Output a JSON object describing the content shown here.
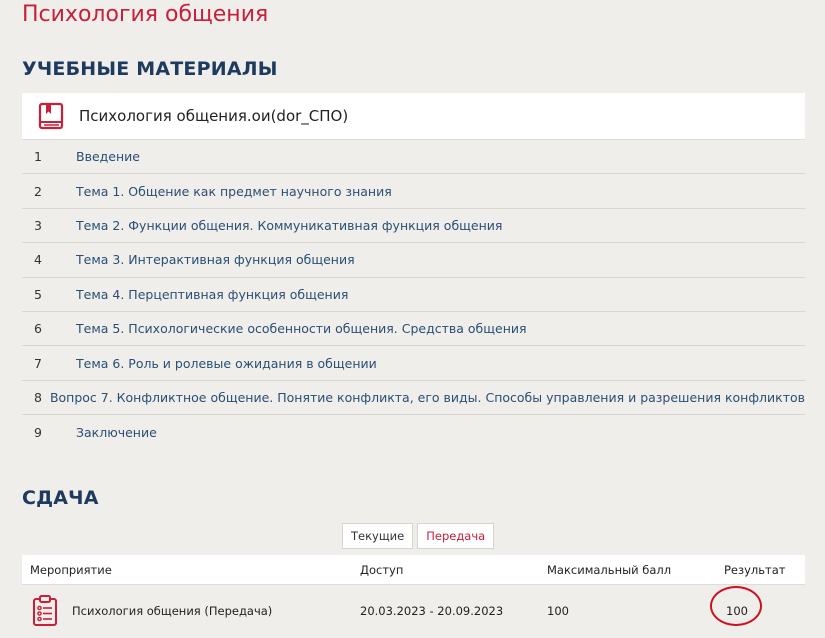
{
  "page_title": "Психология общения",
  "materials": {
    "title": "УЧЕБНЫЕ МАТЕРИАЛЫ",
    "course_name": "Психология общения.ои(dor_СПО)",
    "items": [
      {
        "num": "1",
        "label": "Введение"
      },
      {
        "num": "2",
        "label": "Тема 1. Общение как предмет научного знания"
      },
      {
        "num": "3",
        "label": "Тема 2. Функции общения. Коммуникативная функция общения"
      },
      {
        "num": "4",
        "label": "Тема 3. Интерактивная функция общения"
      },
      {
        "num": "5",
        "label": "Тема 4. Перцептивная функция общения"
      },
      {
        "num": "6",
        "label": "Тема 5. Психологические особенности общения. Средства общения"
      },
      {
        "num": "7",
        "label": "Тема 6. Роль и ролевые ожидания в общении"
      },
      {
        "num": "8",
        "label": "Вопрос 7. Конфликтное общение. Понятие конфликта, его виды. Способы управления и разрешения конфликтов"
      },
      {
        "num": "9",
        "label": "Заключение"
      }
    ]
  },
  "sdacha": {
    "title": "СДАЧА",
    "tabs": {
      "current": "Текущие",
      "retake": "Передача"
    },
    "columns": {
      "event": "Мероприятие",
      "access": "Доступ",
      "max_score": "Максимальный балл",
      "result": "Результат"
    },
    "rows": [
      {
        "event": "Психология общения (Передача)",
        "access": "20.03.2023 - 20.09.2023",
        "max_score": "100",
        "result": "100"
      }
    ]
  },
  "colors": {
    "accent_red": "#c8203a",
    "heading_navy": "#1e3a5f",
    "link_blue": "#2a4f74",
    "circle_red": "#cc1020"
  }
}
